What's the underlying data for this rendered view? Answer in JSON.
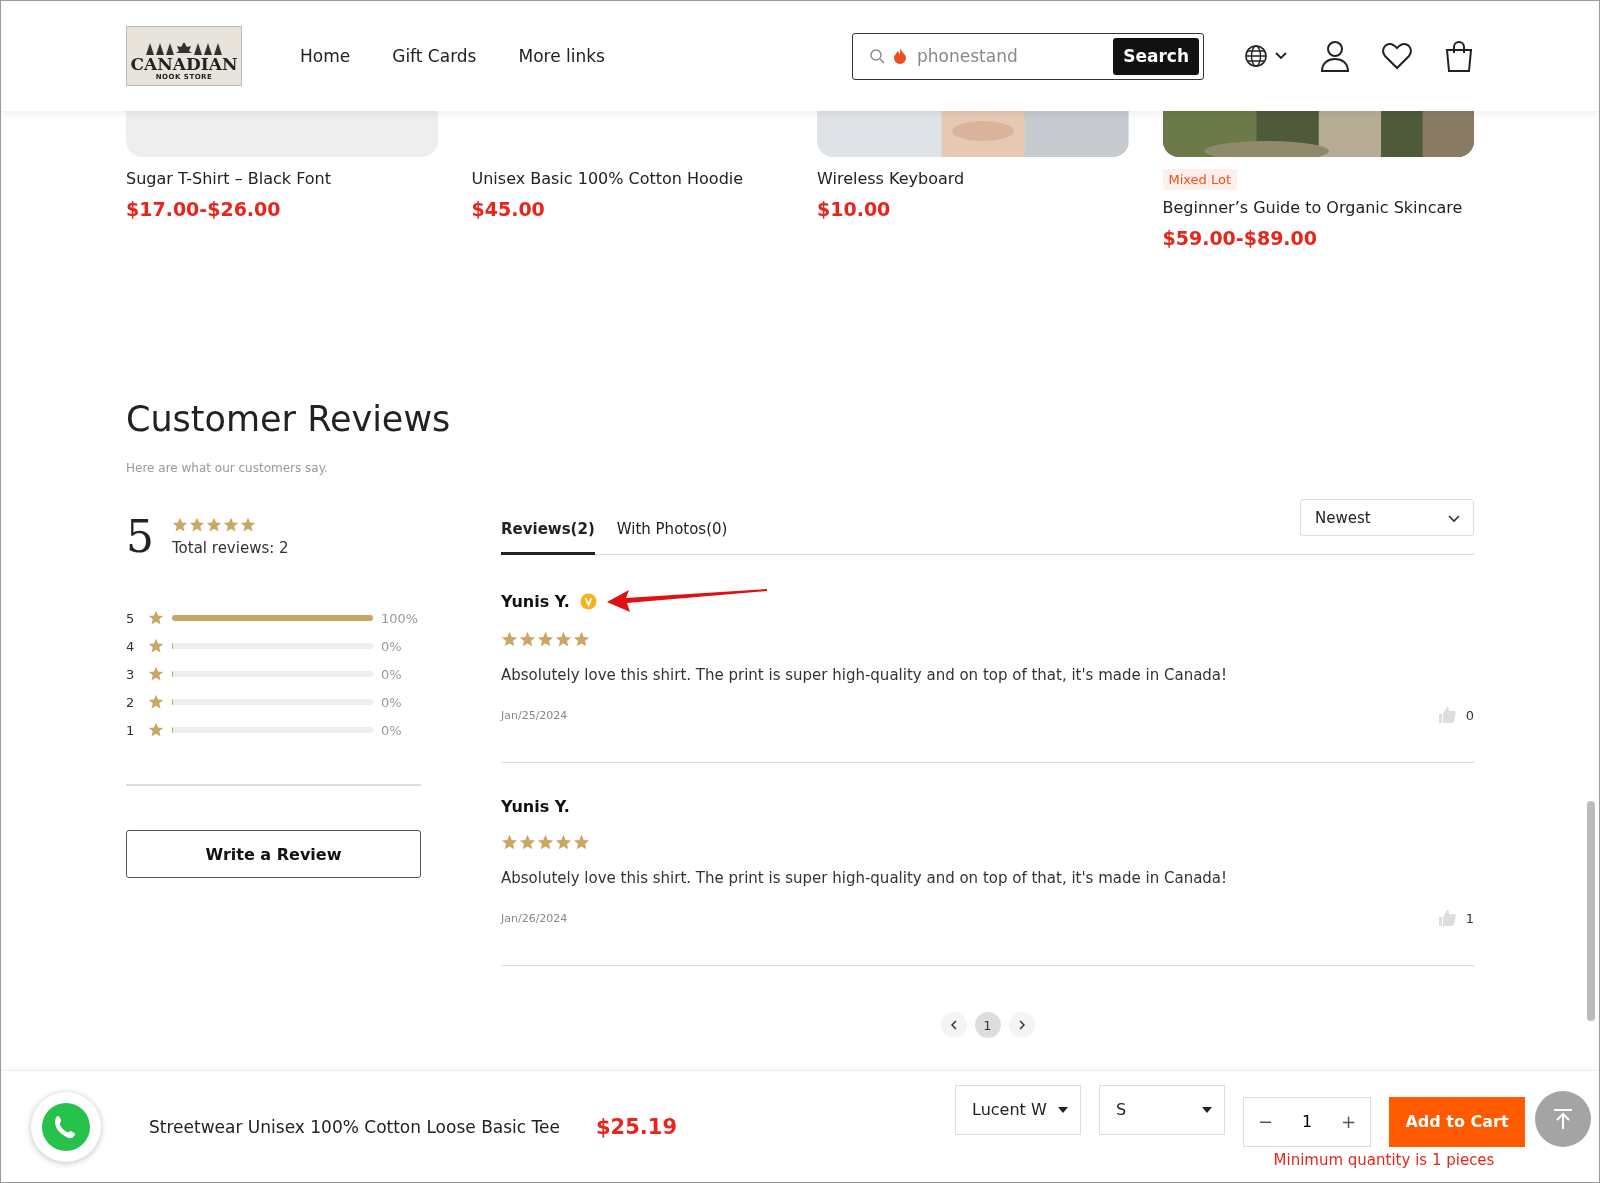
{
  "header": {
    "logo": {
      "line1": "CANADIAN",
      "line2": "NOOK STORE"
    },
    "nav": [
      "Home",
      "Gift Cards",
      "More links"
    ],
    "search": {
      "value": "phonestand",
      "button": "Search"
    }
  },
  "products": [
    {
      "kind": "plain",
      "title": "Sugar T-Shirt – Black Font",
      "price": "$17.00-$26.00"
    },
    {
      "kind": "none",
      "title": "Unisex Basic 100% Cotton Hoodie",
      "price": "$45.00"
    },
    {
      "kind": "picture",
      "title": "Wireless Keyboard",
      "price": "$10.00"
    },
    {
      "kind": "picture",
      "badge": "Mixed Lot",
      "title": "Beginner’s Guide to Organic Skincare",
      "price": "$59.00-$89.00"
    }
  ],
  "reviews": {
    "title": "Customer Reviews",
    "subtitle": "Here are what our customers say.",
    "average": "5",
    "stars": 5,
    "total": "Total reviews: 2",
    "breakdown": [
      {
        "label": "5",
        "level": 1,
        "percent": "100%"
      },
      {
        "label": "4",
        "level": 0,
        "percent": "0%"
      },
      {
        "label": "3",
        "level": 0,
        "percent": "0%"
      },
      {
        "label": "2",
        "level": 0,
        "percent": "0%"
      },
      {
        "label": "1",
        "level": 0,
        "percent": "0%"
      }
    ],
    "write_button": "Write a Review",
    "tabs": [
      {
        "label": "Reviews(2)",
        "selected": true
      },
      {
        "label": "With Photos(0)",
        "selected": false
      }
    ],
    "sort": "Newest",
    "items": [
      {
        "name": "Yunis Y.",
        "verified": true,
        "annotated": true,
        "stars": 5,
        "text": "Absolutely love this shirt. The print is super high-quality and on top of that, it's made in Canada!",
        "date": "Jan/25/2024",
        "likes": "0"
      },
      {
        "name": "Yunis Y.",
        "verified": false,
        "annotated": false,
        "stars": 5,
        "text": "Absolutely love this shirt. The print is super high-quality and on top of that, it's made in Canada!",
        "date": "Jan/26/2024",
        "likes": "1"
      }
    ],
    "pages": [
      {
        "label": "1",
        "selected": true
      }
    ]
  },
  "cart_bar": {
    "product": "Streetwear Unisex 100% Cotton Loose Basic Tee",
    "price": "$25.19",
    "options": [
      "Lucent W",
      "S"
    ],
    "decrement": "−",
    "quantity": "1",
    "increment": "+",
    "button": "Add to Cart",
    "note": "Minimum quantity is 1 pieces"
  }
}
